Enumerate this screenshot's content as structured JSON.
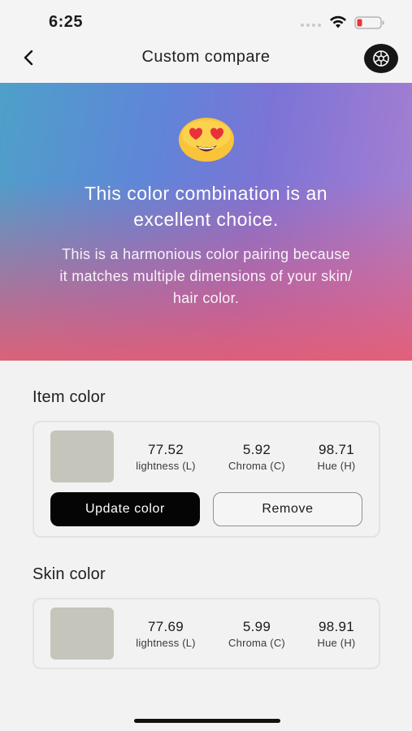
{
  "status_bar": {
    "time": "6:25"
  },
  "nav": {
    "title": "Custom compare"
  },
  "hero": {
    "emoji": "😍",
    "headline_line1": "This color combination is an",
    "headline_line2": "excellent choice.",
    "description_line1": "This is a harmonious color pairing because",
    "description_line2": "it matches multiple dimensions of your skin/",
    "description_line3": "hair color."
  },
  "item_color": {
    "title": "Item color",
    "swatch_color": "#c5c5bb",
    "lightness": {
      "value": "77.52",
      "label": "lightness (L)"
    },
    "chroma": {
      "value": "5.92",
      "label": "Chroma (C)"
    },
    "hue": {
      "value": "98.71",
      "label": "Hue (H)"
    },
    "update_label": "Update color",
    "remove_label": "Remove"
  },
  "skin_color": {
    "title": "Skin color",
    "swatch_color": "#c5c5bb",
    "lightness": {
      "value": "77.69",
      "label": "lightness (L)"
    },
    "chroma": {
      "value": "5.99",
      "label": "Chroma (C)"
    },
    "hue": {
      "value": "98.91",
      "label": "Hue (H)"
    }
  },
  "icons": {
    "back": "chevron-left-icon",
    "profile": "palette-icon",
    "wifi": "wifi-icon",
    "battery": "battery-low-icon"
  },
  "colors": {
    "battery_low": "#e53935",
    "primary_button": "#050505",
    "hero_gradient_start": "#4ea0c9",
    "hero_gradient_end": "#e85c70"
  }
}
